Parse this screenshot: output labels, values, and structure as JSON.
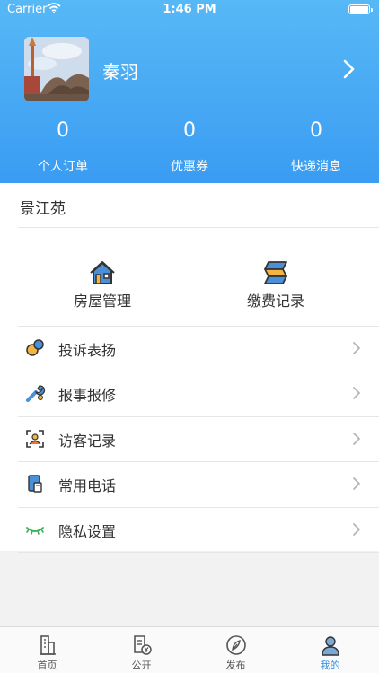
{
  "status_bar": {
    "carrier": "Carrier",
    "time": "1:46 PM"
  },
  "profile": {
    "name": "秦羽"
  },
  "stats": [
    {
      "value": "0",
      "label": "个人订单"
    },
    {
      "value": "0",
      "label": "优惠券"
    },
    {
      "value": "0",
      "label": "快递消息"
    }
  ],
  "community": {
    "name": "景江苑"
  },
  "quick_actions": [
    {
      "label": "房屋管理",
      "icon": "house-icon"
    },
    {
      "label": "缴费记录",
      "icon": "payment-record-icon"
    }
  ],
  "menu": [
    {
      "label": "投诉表扬",
      "icon": "complaint-praise-icon"
    },
    {
      "label": "报事报修",
      "icon": "wrench-icon"
    },
    {
      "label": "访客记录",
      "icon": "visitor-scan-icon"
    },
    {
      "label": "常用电话",
      "icon": "phone-book-icon"
    },
    {
      "label": "隐私设置",
      "icon": "closed-eye-icon"
    }
  ],
  "tabs": [
    {
      "label": "首页",
      "icon": "building-icon"
    },
    {
      "label": "公开",
      "icon": "document-yen-icon"
    },
    {
      "label": "发布",
      "icon": "leaf-pen-icon"
    },
    {
      "label": "我的",
      "icon": "user-icon",
      "active": true
    }
  ],
  "colors": {
    "header_top": "#57b8f6",
    "header_bottom": "#3a9cf2",
    "active_tab": "#2f8ce6"
  }
}
